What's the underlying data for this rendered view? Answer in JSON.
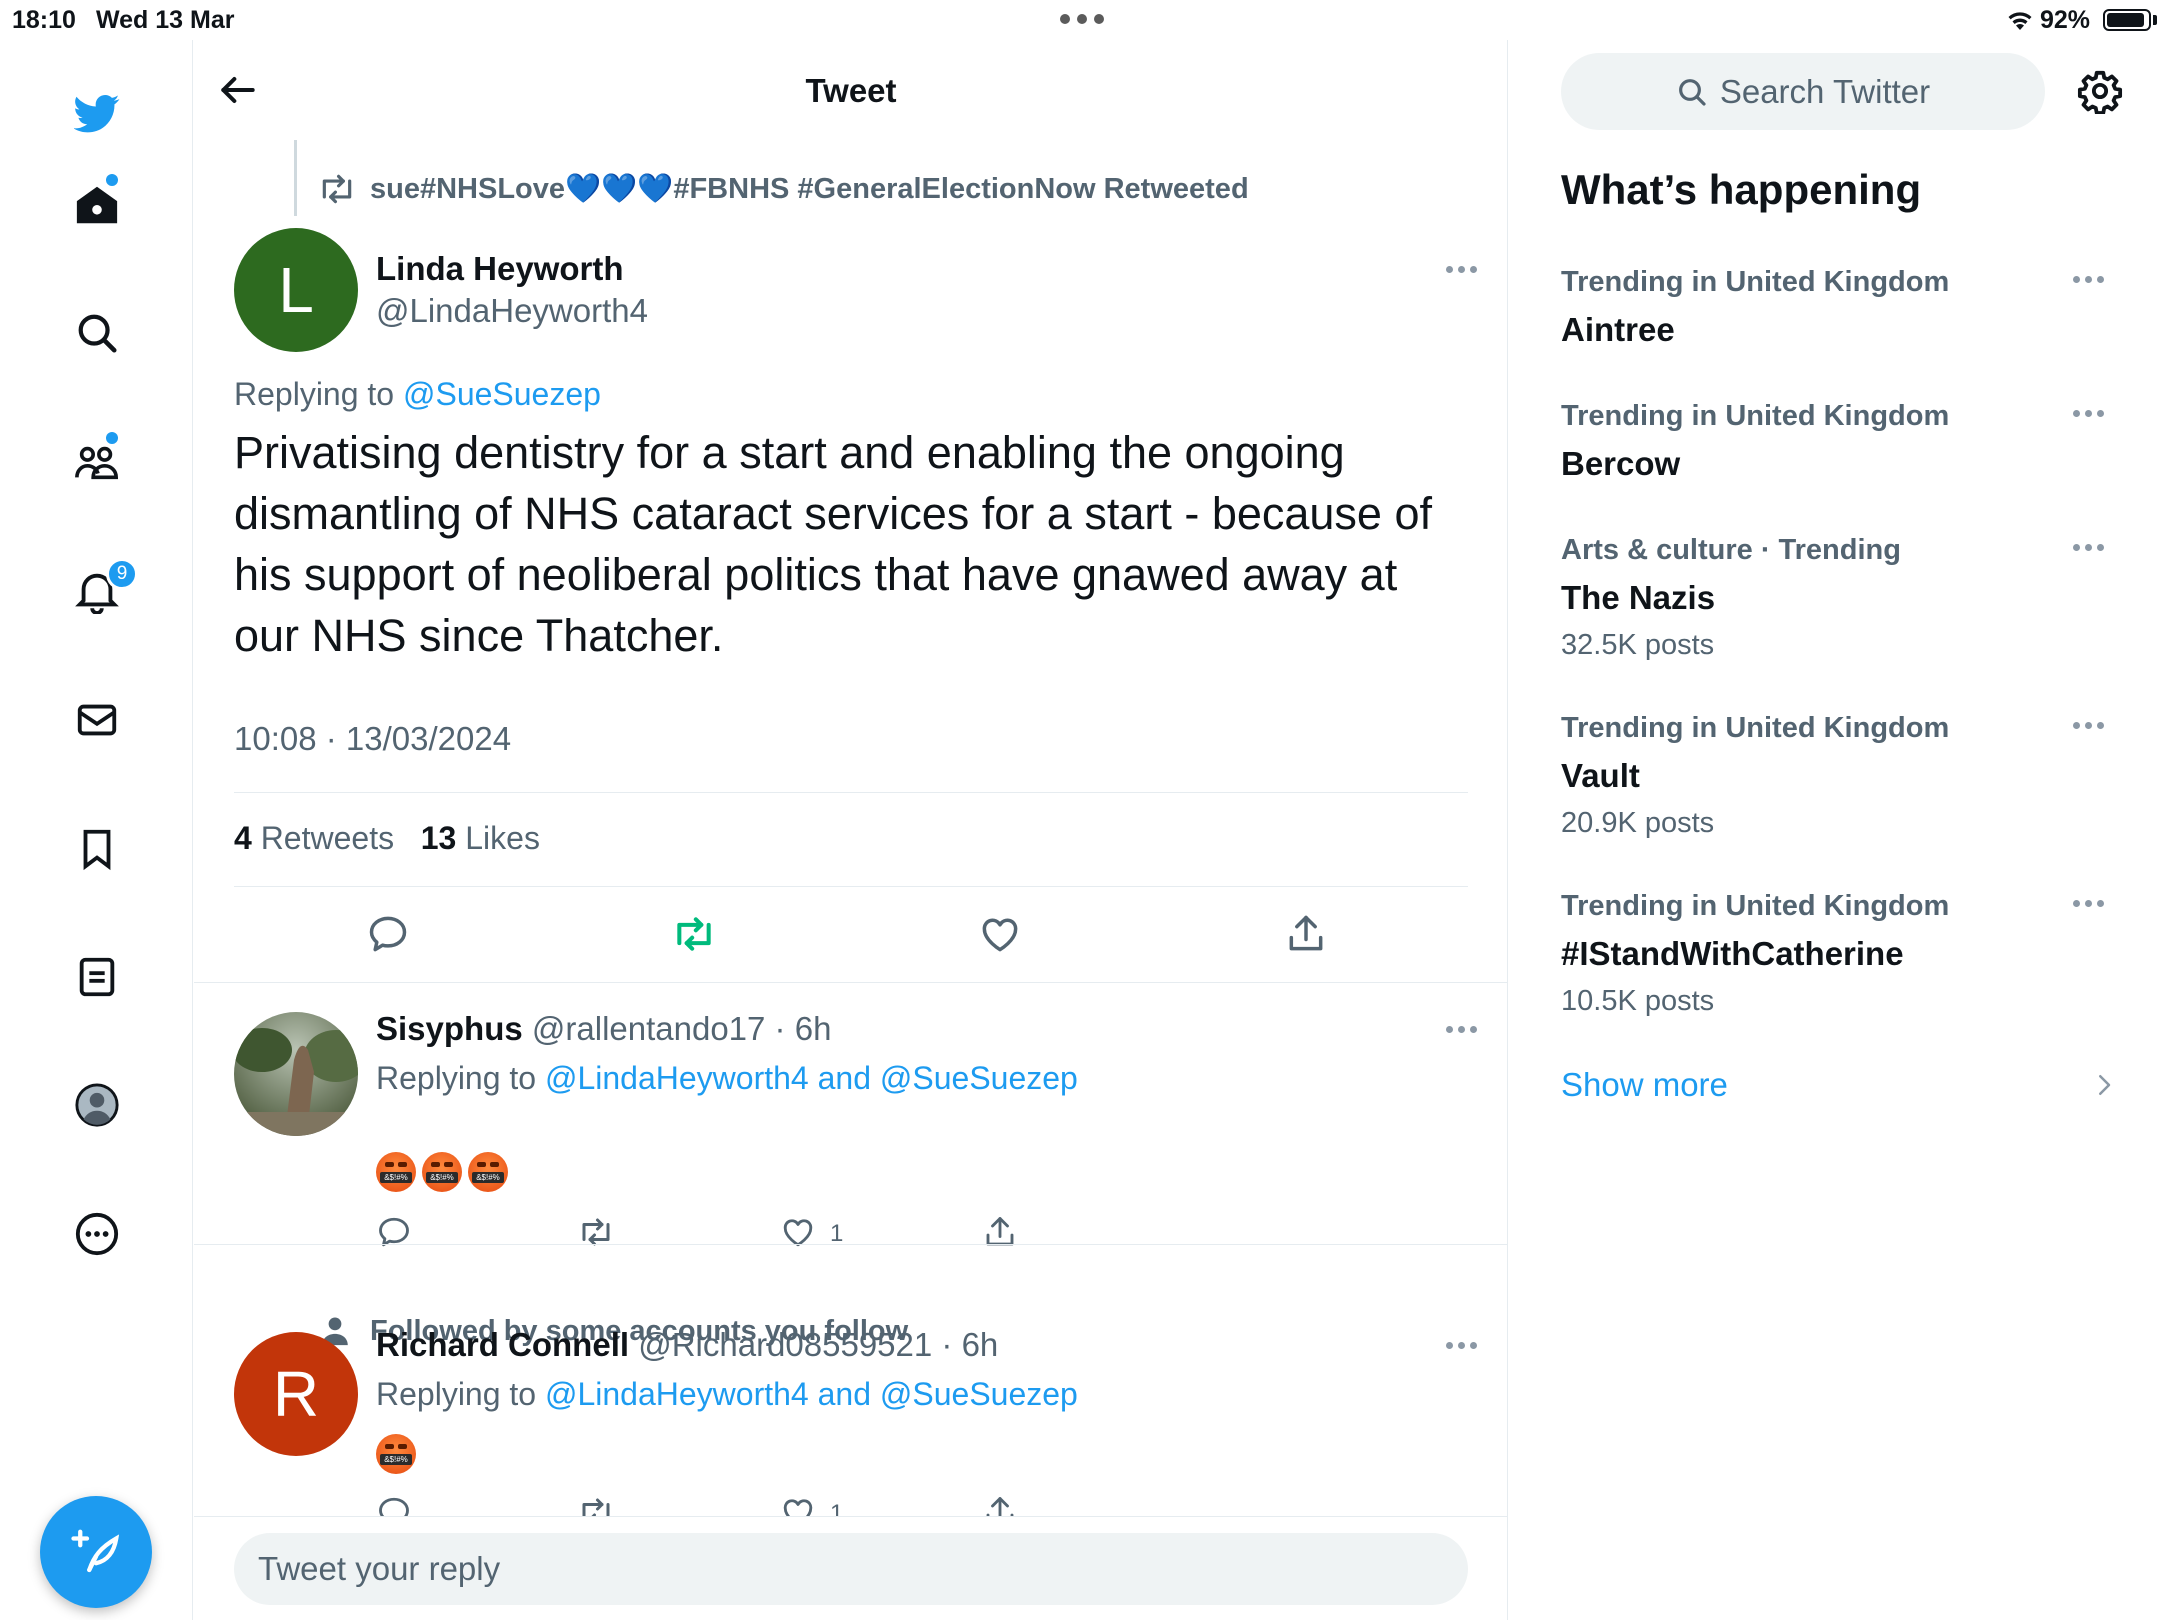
{
  "status_bar": {
    "time": "18:10",
    "date": "Wed 13 Mar",
    "battery": "92%"
  },
  "header": {
    "title": "Tweet"
  },
  "retweet_context": {
    "text": "sue#NHSLove💙💙💙#FBNHS #GeneralElectionNow Retweeted"
  },
  "main_tweet": {
    "avatar_letter": "L",
    "name": "Linda Heyworth",
    "handle": "@LindaHeyworth4",
    "replying_prefix": "Replying to",
    "replying_to": "@SueSuezep",
    "text": "Privatising dentistry for a start and enabling the ongoing dismantling of NHS cataract services for a start - because of his support of neoliberal politics that have gnawed away at our NHS since Thatcher.",
    "timestamp": "10:08 · 13/03/2024",
    "retweets_count": "4",
    "retweets_label": "Retweets",
    "likes_count": "13",
    "likes_label": "Likes"
  },
  "replies": [
    {
      "name": "Sisyphus",
      "handle_time": "@rallentando17 · 6h",
      "replying_prefix": "Replying to",
      "replying_to": "@LindaHeyworth4 and @SueSuezep",
      "like_count": "1"
    },
    {
      "social_context": "Followed by some accounts you follow",
      "avatar_letter": "R",
      "name": "Richard Connell",
      "handle_time": "@Richard08559521 · 6h",
      "replying_prefix": "Replying to",
      "replying_to": "@LindaHeyworth4 and @SueSuezep",
      "like_count": "1"
    }
  ],
  "reply_bar": {
    "placeholder": "Tweet your reply"
  },
  "sidebar_right": {
    "search_placeholder": "Search Twitter",
    "section_title": "What’s happening",
    "trends": [
      {
        "context": "Trending in United Kingdom",
        "name": "Aintree",
        "posts": ""
      },
      {
        "context": "Trending in United Kingdom",
        "name": "Bercow",
        "posts": ""
      },
      {
        "context": "Arts & culture · Trending",
        "name": "The Nazis",
        "posts": "32.5K posts"
      },
      {
        "context": "Trending in United Kingdom",
        "name": "Vault",
        "posts": "20.9K posts"
      },
      {
        "context": "Trending in United Kingdom",
        "name": "#IStandWithCatherine",
        "posts": "10.5K posts"
      }
    ],
    "show_more": "Show more"
  },
  "left_nav": {
    "notification_badge": "9"
  },
  "colors": {
    "accent": "#1d9bf0",
    "retweet_green": "#00ba7c",
    "text": "#0f1419",
    "muted": "#536471"
  }
}
